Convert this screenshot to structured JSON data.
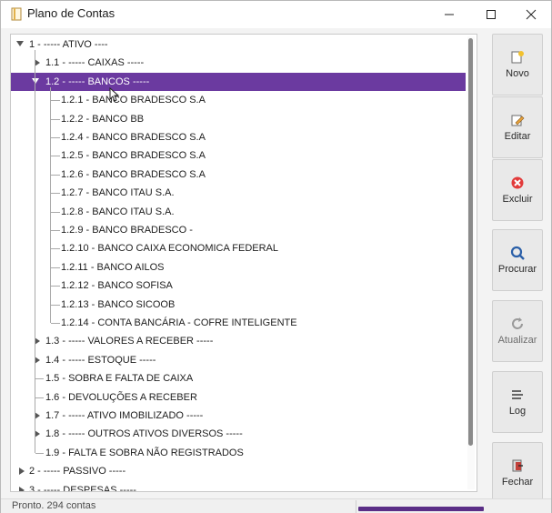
{
  "window": {
    "title": "Plano de Contas"
  },
  "tree": {
    "rows": [
      {
        "label": "1 - -----  ATIVO ----",
        "level": 0,
        "state": "expanded"
      },
      {
        "label": "1.1 - ----- CAIXAS -----",
        "level": 1,
        "state": "collapsed"
      },
      {
        "label": "1.2 - ----- BANCOS -----",
        "level": 1,
        "state": "expanded",
        "selected": true
      },
      {
        "label": "1.2.1 - BANCO BRADESCO S.A",
        "level": 2,
        "state": "leaf"
      },
      {
        "label": "1.2.2 - BANCO BB",
        "level": 2,
        "state": "leaf"
      },
      {
        "label": "1.2.4 - BANCO BRADESCO S.A",
        "level": 2,
        "state": "leaf"
      },
      {
        "label": "1.2.5 - BANCO BRADESCO S.A",
        "level": 2,
        "state": "leaf"
      },
      {
        "label": "1.2.6 - BANCO BRADESCO S.A",
        "level": 2,
        "state": "leaf"
      },
      {
        "label": "1.2.7 - BANCO ITAU S.A.",
        "level": 2,
        "state": "leaf"
      },
      {
        "label": "1.2.8 - BANCO ITAU S.A.",
        "level": 2,
        "state": "leaf"
      },
      {
        "label": "1.2.9 - BANCO BRADESCO -",
        "level": 2,
        "state": "leaf"
      },
      {
        "label": "1.2.10 - BANCO CAIXA ECONOMICA FEDERAL",
        "level": 2,
        "state": "leaf"
      },
      {
        "label": "1.2.11 - BANCO AILOS",
        "level": 2,
        "state": "leaf"
      },
      {
        "label": "1.2.12 - BANCO SOFISA",
        "level": 2,
        "state": "leaf"
      },
      {
        "label": "1.2.13 - BANCO SICOOB",
        "level": 2,
        "state": "leaf"
      },
      {
        "label": "1.2.14 - CONTA BANCÁRIA - COFRE INTELIGENTE",
        "level": 2,
        "state": "leaf"
      },
      {
        "label": "1.3 - ----- VALORES A RECEBER -----",
        "level": 1,
        "state": "collapsed"
      },
      {
        "label": "1.4 - ----- ESTOQUE -----",
        "level": 1,
        "state": "collapsed"
      },
      {
        "label": "1.5 - SOBRA  E FALTA DE CAIXA",
        "level": 1,
        "state": "leaf"
      },
      {
        "label": "1.6 - DEVOLUÇÕES A RECEBER",
        "level": 1,
        "state": "leaf"
      },
      {
        "label": "1.7 - ----- ATIVO IMOBILIZADO -----",
        "level": 1,
        "state": "collapsed"
      },
      {
        "label": "1.8 - ----- OUTROS ATIVOS DIVERSOS -----",
        "level": 1,
        "state": "collapsed"
      },
      {
        "label": "1.9 - FALTA E SOBRA NÃO REGISTRADOS",
        "level": 1,
        "state": "leaf"
      },
      {
        "label": "2 - ----- PASSIVO -----",
        "level": 0,
        "state": "collapsed"
      },
      {
        "label": "3 - ----- DESPESAS -----",
        "level": 0,
        "state": "collapsed"
      }
    ]
  },
  "sidebar": {
    "buttons": [
      {
        "key": "novo",
        "label": "Novo",
        "icon": "new-document-icon",
        "enabled": true
      },
      {
        "key": "editar",
        "label": "Editar",
        "icon": "edit-pencil-icon",
        "enabled": true
      },
      {
        "key": "excluir",
        "label": "Excluir",
        "icon": "delete-x-icon",
        "enabled": true
      },
      {
        "key": "procurar",
        "label": "Procurar",
        "icon": "search-magnifier-icon",
        "enabled": true
      },
      {
        "key": "atualizar",
        "label": "Atualizar",
        "icon": "refresh-icon",
        "enabled": false
      },
      {
        "key": "log",
        "label": "Log",
        "icon": "log-lines-icon",
        "enabled": true
      },
      {
        "key": "fechar",
        "label": "Fechar",
        "icon": "exit-door-icon",
        "enabled": true
      }
    ]
  },
  "status": {
    "text": "Pronto. 294 contas"
  },
  "colors": {
    "selection": "#6b3aa0",
    "progress": "#5a2e86"
  }
}
